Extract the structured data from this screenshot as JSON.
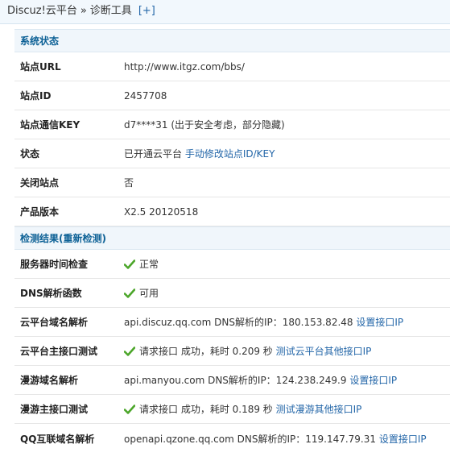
{
  "breadcrumb": {
    "root": "Discuz!云平台",
    "separator": "»",
    "current": "诊断工具",
    "add_label": "[+]"
  },
  "system_status": {
    "title": "系统状态",
    "rows": [
      {
        "label": "站点URL",
        "value": "http://www.itgz.com/bbs/"
      },
      {
        "label": "站点ID",
        "value": "2457708"
      },
      {
        "label": "站点通信KEY",
        "value": "d7****31 (出于安全考虑，部分隐藏)"
      },
      {
        "label": "状态",
        "value": "已开通云平台",
        "link": "手动修改站点ID/KEY"
      },
      {
        "label": "关闭站点",
        "value": "否"
      },
      {
        "label": "产品版本",
        "value": "X2.5 20120518"
      }
    ]
  },
  "check_results": {
    "title": "检测结果",
    "recheck_open": "(",
    "recheck_link": "重新检测",
    "recheck_close": ")",
    "rows": [
      {
        "label": "服务器时间检查",
        "value": "正常"
      },
      {
        "label": "DNS解析函数",
        "value": "可用"
      },
      {
        "label": "云平台域名解析",
        "value": "api.discuz.qq.com DNS解析的IP：180.153.82.48",
        "link": "设置接口IP"
      },
      {
        "label": "云平台主接口测试",
        "value": "请求接口 成功，耗时 0.209 秒",
        "link": "测试云平台其他接口IP"
      },
      {
        "label": "漫游域名解析",
        "value": "api.manyou.com DNS解析的IP：124.238.249.9",
        "link": "设置接口IP"
      },
      {
        "label": "漫游主接口测试",
        "value": "请求接口 成功，耗时 0.189 秒",
        "link": "测试漫游其他接口IP"
      },
      {
        "label": "QQ互联域名解析",
        "value": "openapi.qzone.qq.com DNS解析的IP：119.147.79.31",
        "link": "设置接口IP"
      }
    ]
  },
  "colors": {
    "section_title": "#0d6196",
    "link": "#2366a8",
    "check": "#4ca62a"
  },
  "icons": {
    "ok": "check-icon"
  }
}
